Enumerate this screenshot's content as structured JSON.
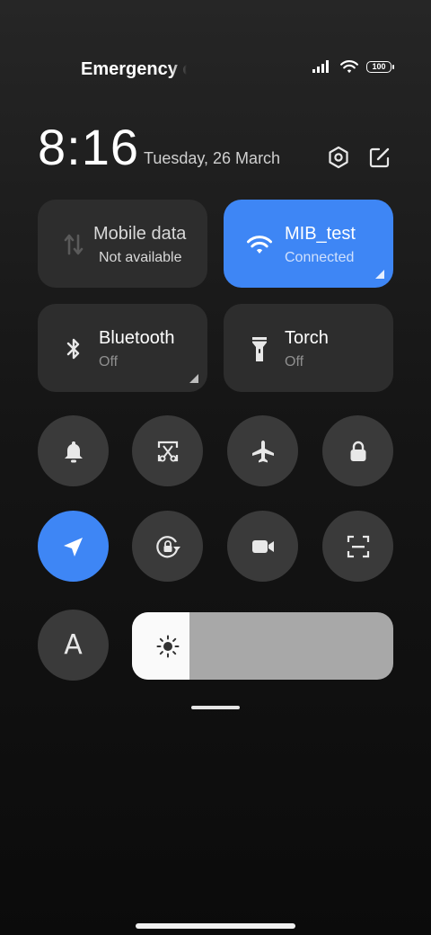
{
  "status_bar": {
    "carrier_text": "Emergency calls only",
    "battery_level": "100",
    "signal_icon": "signal-icon",
    "wifi_icon": "wifi-icon"
  },
  "header": {
    "time": "8:16",
    "date": "Tuesday, 26 March",
    "settings_icon": "settings-icon",
    "edit_icon": "edit-icon"
  },
  "tiles": {
    "mobile_data": {
      "title": "Mobile data",
      "subtitle": "Not available",
      "icon": "mobile-data-icon",
      "active": false
    },
    "wifi": {
      "title": "MIB_test",
      "subtitle": "Connected",
      "icon": "wifi-icon",
      "active": true
    },
    "bluetooth": {
      "title": "Bluetooth",
      "subtitle": "Off",
      "icon": "bluetooth-icon",
      "active": false
    },
    "torch": {
      "title": "Torch",
      "subtitle": "Off",
      "icon": "torch-icon",
      "active": false
    }
  },
  "toggles": [
    {
      "name": "bell-icon",
      "active": false
    },
    {
      "name": "screenshot-icon",
      "active": false
    },
    {
      "name": "airplane-icon",
      "active": false
    },
    {
      "name": "lock-icon",
      "active": false
    },
    {
      "name": "location-icon",
      "active": true
    },
    {
      "name": "auto-rotate-icon",
      "active": false
    },
    {
      "name": "screen-record-icon",
      "active": false
    },
    {
      "name": "scanner-icon",
      "active": false
    },
    {
      "name": "reading-mode-icon",
      "active": false
    }
  ],
  "reading_mode_label": "A",
  "brightness": {
    "level": 0.22,
    "icon": "brightness-icon"
  },
  "colors": {
    "accent": "#3e86f5",
    "tile_bg": "#2d2d2d",
    "round_bg": "#3a3a3a"
  }
}
